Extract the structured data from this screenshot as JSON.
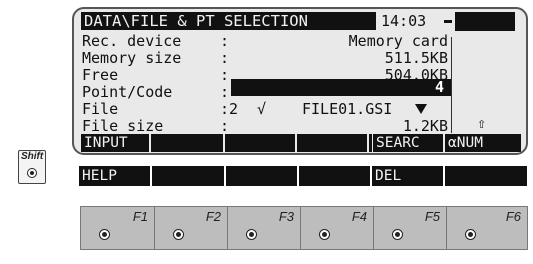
{
  "screen": {
    "title": "DATA\\FILE & PT SELECTION",
    "clock": "14:03",
    "rows": [
      {
        "label": "Rec. device",
        "sep": ":",
        "value": "Memory card"
      },
      {
        "label": "Memory size",
        "sep": ":",
        "value": "511.5KB"
      },
      {
        "label": "Free",
        "sep": ":",
        "value": "504.0KB"
      },
      {
        "label": "Point/Code",
        "sep": ":",
        "value": "4"
      },
      {
        "label": "File",
        "sep": ":",
        "file_number": "2",
        "check": "√",
        "value": "FILE01.GSI"
      },
      {
        "label": "File size",
        "sep": ":",
        "value": "1.2KB"
      }
    ],
    "scroll_arrow": "⇧",
    "softkeys": [
      "INPUT",
      "",
      "",
      "",
      "",
      "SEARC",
      "αNUM"
    ]
  },
  "shift": {
    "label": "Shift",
    "softkeys": [
      "HELP",
      "",
      "",
      "",
      "DEL",
      ""
    ]
  },
  "function_keys": [
    "F1",
    "F2",
    "F3",
    "F4",
    "F5",
    "F6"
  ]
}
